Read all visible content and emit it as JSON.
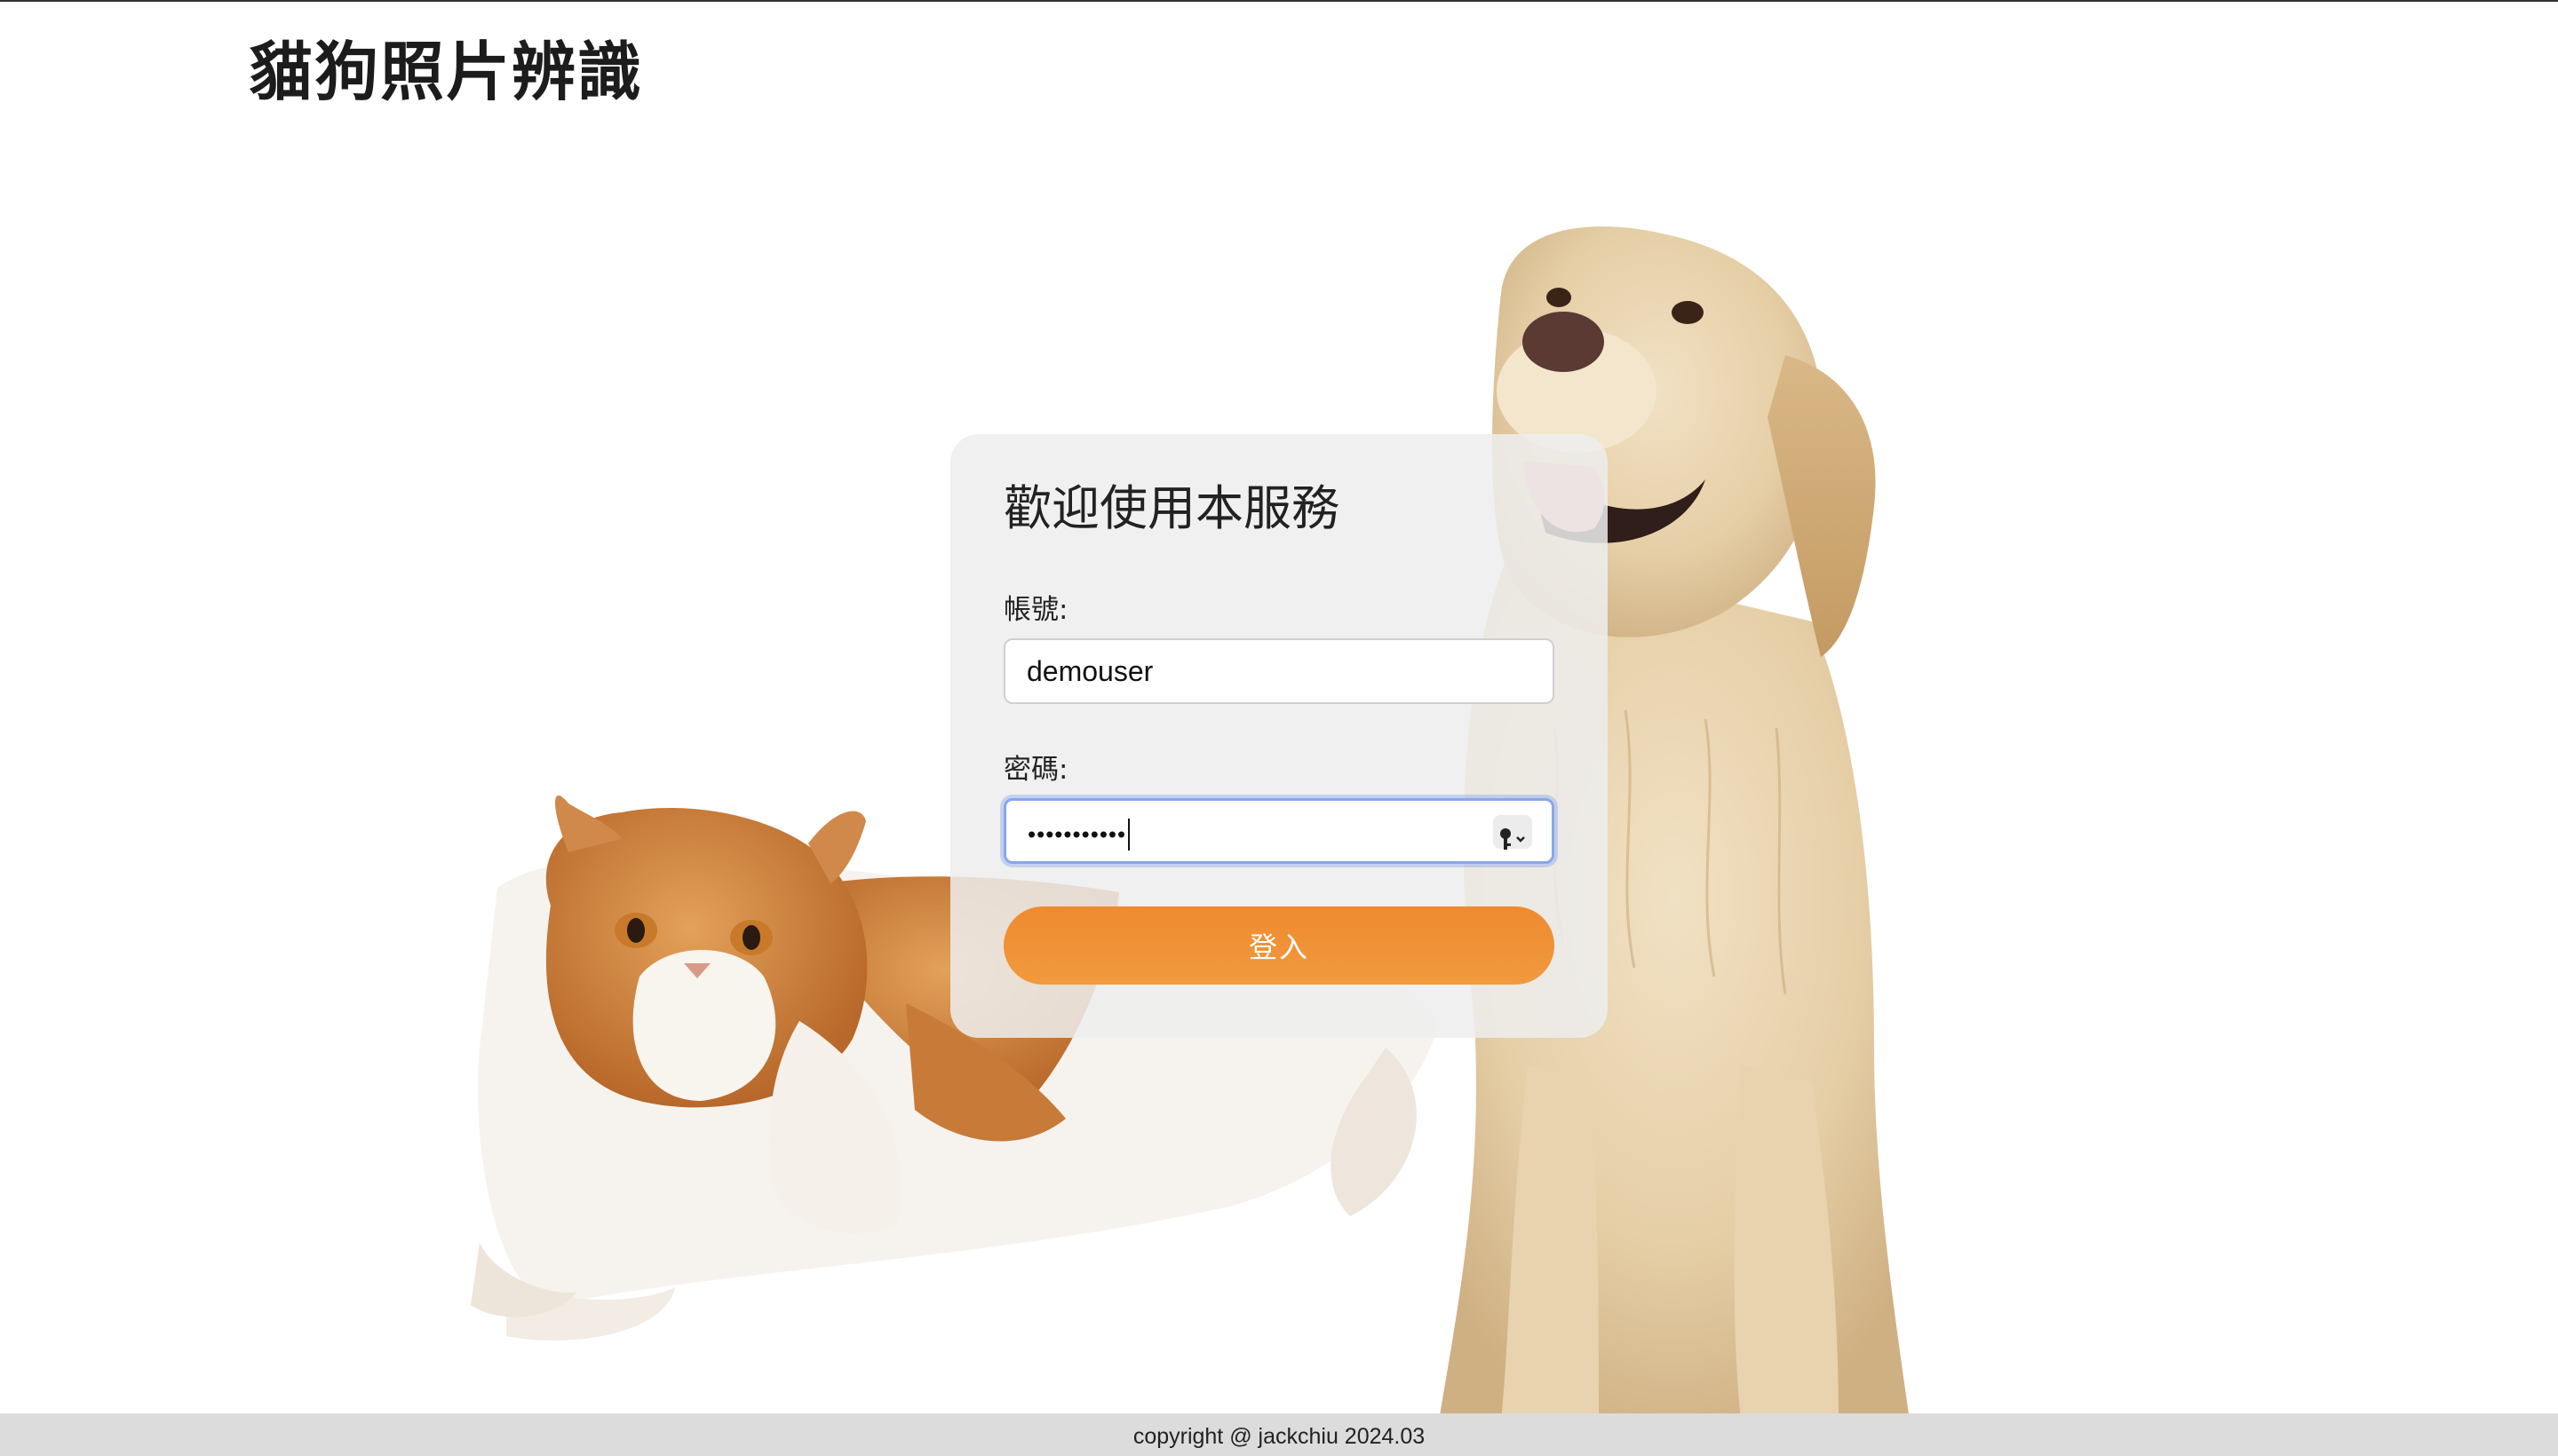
{
  "header": {
    "brand_title": "貓狗照片辨識"
  },
  "login": {
    "title": "歡迎使用本服務",
    "username_label": "帳號:",
    "username_value": "demouser",
    "password_label": "密碼:",
    "password_masked": "•••••••••••",
    "submit_label": "登入"
  },
  "footer": {
    "copyright": "copyright @ jackchiu 2024.03"
  },
  "colors": {
    "accent_button": "#ef8a30",
    "card_bg": "#eeeeee",
    "focus_ring": "#8aa6e6",
    "footer_bg": "#dcdcdc"
  },
  "icons": {
    "password_manager": "key-icon",
    "dropdown": "chevron-down-icon"
  }
}
